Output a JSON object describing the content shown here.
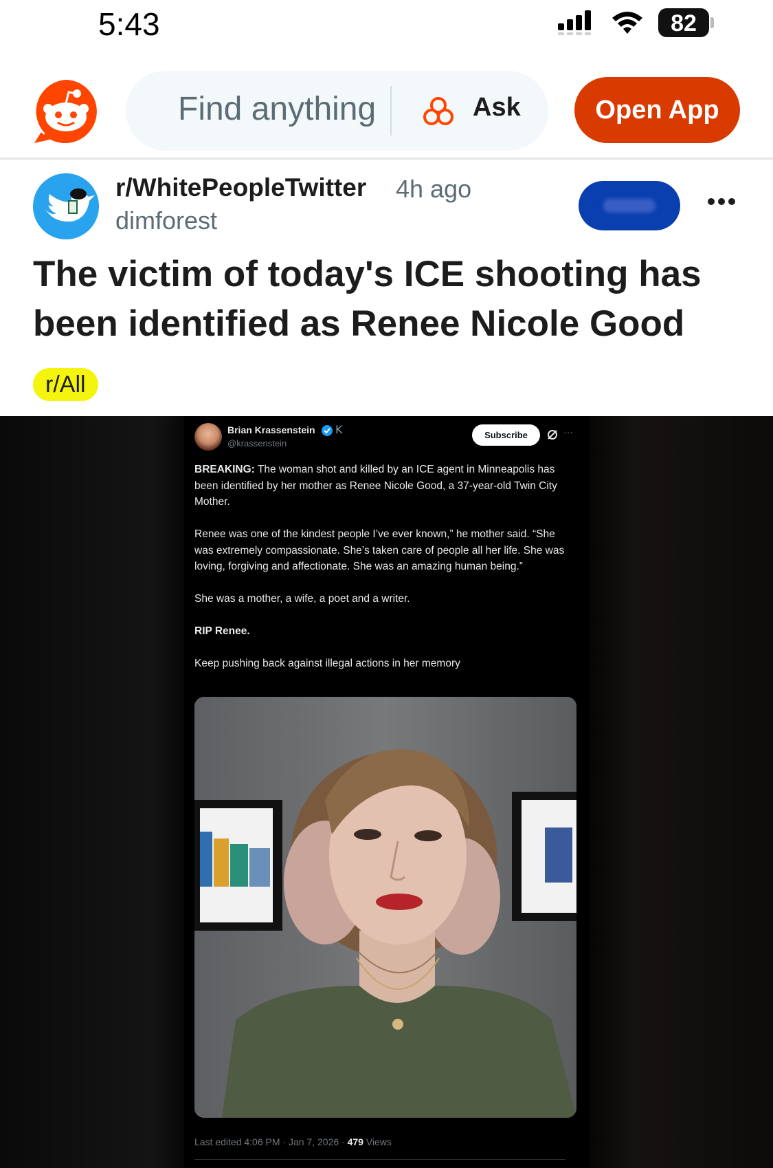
{
  "status_bar": {
    "time": "5:43",
    "battery": "82"
  },
  "header": {
    "search_placeholder": "Find anything",
    "ask_label": "Ask",
    "open_app_label": "Open App",
    "brand_color": "#ff4500",
    "button_color": "#d93a00"
  },
  "post": {
    "subreddit": "r/WhitePeopleTwitter",
    "time_ago": "4h ago",
    "username": "dimforest",
    "title": "The victim of today's ICE shooting has been identified as Renee Nicole Good",
    "flair": "r/All",
    "flair_color": "#f5f40f",
    "join_color": "#0a3fb0"
  },
  "tweet": {
    "author": "Brian Krassenstein",
    "handle": "@krassenstein",
    "subscribe_label": "Subscribe",
    "breaking_label": "BREAKING:",
    "paragraph1": "The woman shot and killed by an ICE agent in Minneapolis has been identified by her mother as Renee Nicole Good, a 37-year-old Twin City Mother.",
    "paragraph2": "Renee was one of the kindest people I’ve ever known,” he mother said. “She was extremely compassionate. She’s taken care of people all her life. She was loving, forgiving and affectionate. She was an amazing human being.”",
    "paragraph3": "She was a mother, a wife, a poet and a writer.",
    "paragraph4": "RIP Renee.",
    "paragraph5": "Keep pushing back against illegal actions in her memory",
    "meta_prefix": "Last edited 4:06 PM · Jan 7, 2026 · ",
    "views_count": "479",
    "views_label": " Views"
  }
}
